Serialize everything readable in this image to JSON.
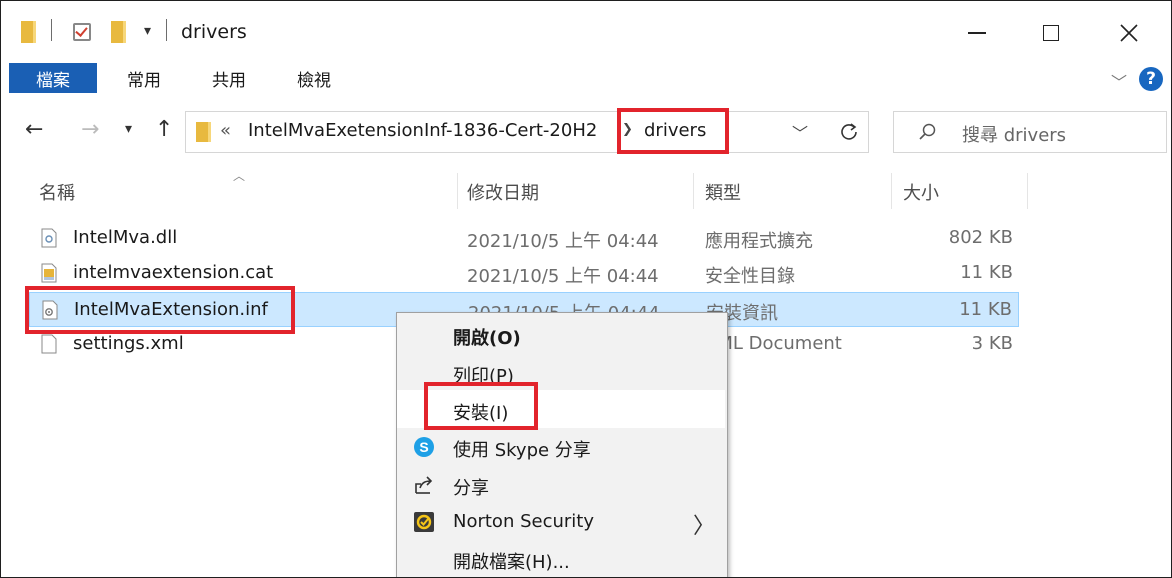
{
  "window": {
    "title": "drivers",
    "colors": {
      "accent": "#1a5fb4",
      "selection": "#cce8ff",
      "highlight": "#e2242c"
    }
  },
  "ribbon": {
    "tabs": [
      "檔案",
      "常用",
      "共用",
      "檢視"
    ],
    "help_label": "?"
  },
  "address": {
    "overflow_label": "«",
    "segments": [
      "IntelMvaExetensionInf-1836-Cert-20H2",
      "drivers"
    ]
  },
  "search": {
    "placeholder": "搜尋 drivers"
  },
  "columns": {
    "name": "名稱",
    "modified": "修改日期",
    "type": "類型",
    "size": "大小"
  },
  "files": [
    {
      "name": "IntelMva.dll",
      "modified": "2021/10/5 上午 04:44",
      "type": "應用程式擴充",
      "size": "802 KB",
      "icon": "dll-file-icon"
    },
    {
      "name": "intelmvaextension.cat",
      "modified": "2021/10/5 上午 04:44",
      "type": "安全性目錄",
      "size": "11 KB",
      "icon": "cat-file-icon"
    },
    {
      "name": "IntelMvaExtension.inf",
      "modified": "2021/10/5 上午 04:44",
      "type": "安裝資訊",
      "size": "11 KB",
      "icon": "inf-file-icon"
    },
    {
      "name": "settings.xml",
      "modified": "",
      "type": "XML Document",
      "size": "3 KB",
      "icon": "xml-file-icon"
    }
  ],
  "context_menu": {
    "items": [
      {
        "label": "開啟(O)",
        "bold": true
      },
      {
        "label": "列印(P)"
      },
      {
        "label": "安裝(I)",
        "hover": true
      },
      {
        "label": "使用 Skype 分享",
        "icon": "skype-icon"
      },
      {
        "label": "分享",
        "icon": "share-icon"
      },
      {
        "label": "Norton Security",
        "icon": "norton-icon",
        "submenu": true
      },
      {
        "label": "開啟檔案(H)..."
      }
    ]
  }
}
